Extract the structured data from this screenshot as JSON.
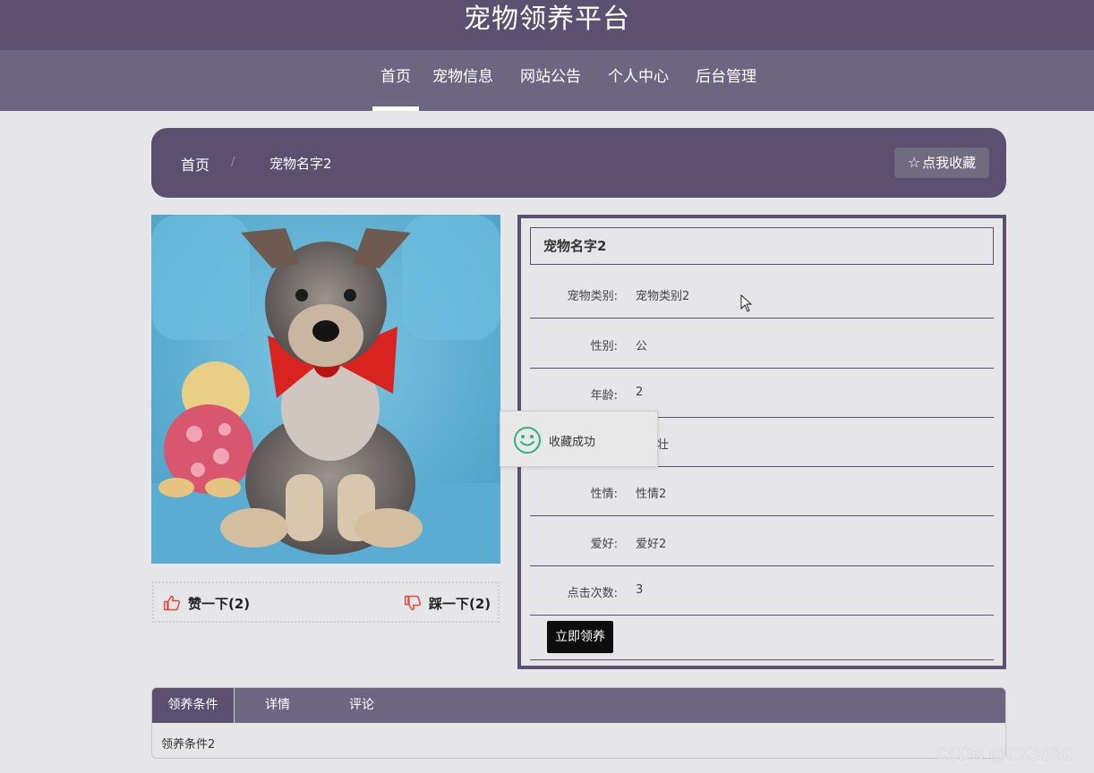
{
  "site": {
    "title": "宠物领养平台"
  },
  "nav": {
    "items": [
      {
        "label": "首页"
      },
      {
        "label": "宠物信息"
      },
      {
        "label": "网站公告"
      },
      {
        "label": "个人中心"
      },
      {
        "label": "后台管理"
      }
    ],
    "active_index": 0
  },
  "breadcrumb": {
    "home": "首页",
    "separator": "/",
    "current": "宠物名字2",
    "favorite_button": "点我收藏"
  },
  "pet": {
    "name": "宠物名字2",
    "fields": [
      {
        "label": "宠物类别:",
        "value": "宠物类别2"
      },
      {
        "label": "性别:",
        "value": "公"
      },
      {
        "label": "年龄:",
        "value": "2"
      },
      {
        "label": "",
        "value": ""
      },
      {
        "label": "性情:",
        "value": "性情2"
      },
      {
        "label": "爱好:",
        "value": "爱好2"
      },
      {
        "label": "点击次数:",
        "value": "3"
      }
    ],
    "partial_value": "壮",
    "adopt_button": "立即领养"
  },
  "votes": {
    "like_label": "赞一下(2)",
    "dislike_label": "踩一下(2)"
  },
  "toast": {
    "message": "收藏成功"
  },
  "tabs": {
    "items": [
      {
        "label": "领养条件"
      },
      {
        "label": "详情"
      },
      {
        "label": "评论"
      }
    ],
    "active_index": 0,
    "content": "领养条件2"
  },
  "watermark": "CSDN @CK3036",
  "colors": {
    "header": "#5b506f",
    "nav": "#6c6680",
    "background": "#e6e5e7",
    "vote_icon": "#e04b3a",
    "toast_icon": "#2fb37a"
  }
}
